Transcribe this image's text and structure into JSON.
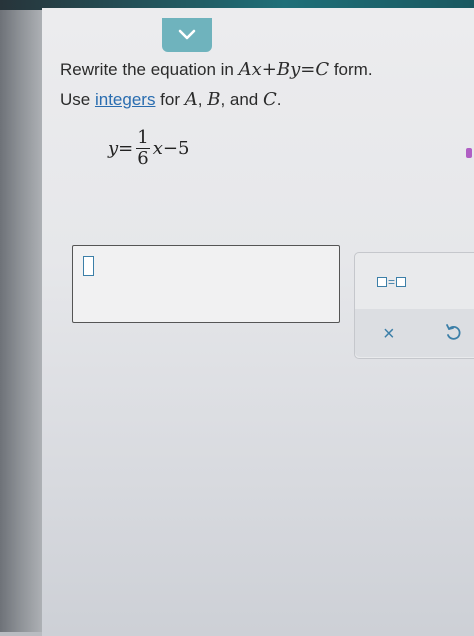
{
  "question": {
    "line1_prefix": "Rewrite the equation in ",
    "line1_math": "Ax+By=C",
    "line1_suffix": " form.",
    "line2_prefix": "Use ",
    "line2_link": "integers",
    "line2_middle": " for ",
    "var_a": "A",
    "sep1": ", ",
    "var_b": "B",
    "sep2": ", and ",
    "var_c": "C",
    "end": "."
  },
  "equation": {
    "lhs": "y",
    "equals": "=",
    "numerator": "1",
    "denominator": "6",
    "var": "x",
    "rest": "−5"
  },
  "toolbar": {
    "equals_symbol": "=",
    "clear_label": "×"
  },
  "colors": {
    "accent": "#3c7fa8",
    "tab": "#6fb3bd",
    "link": "#2a6db0"
  }
}
